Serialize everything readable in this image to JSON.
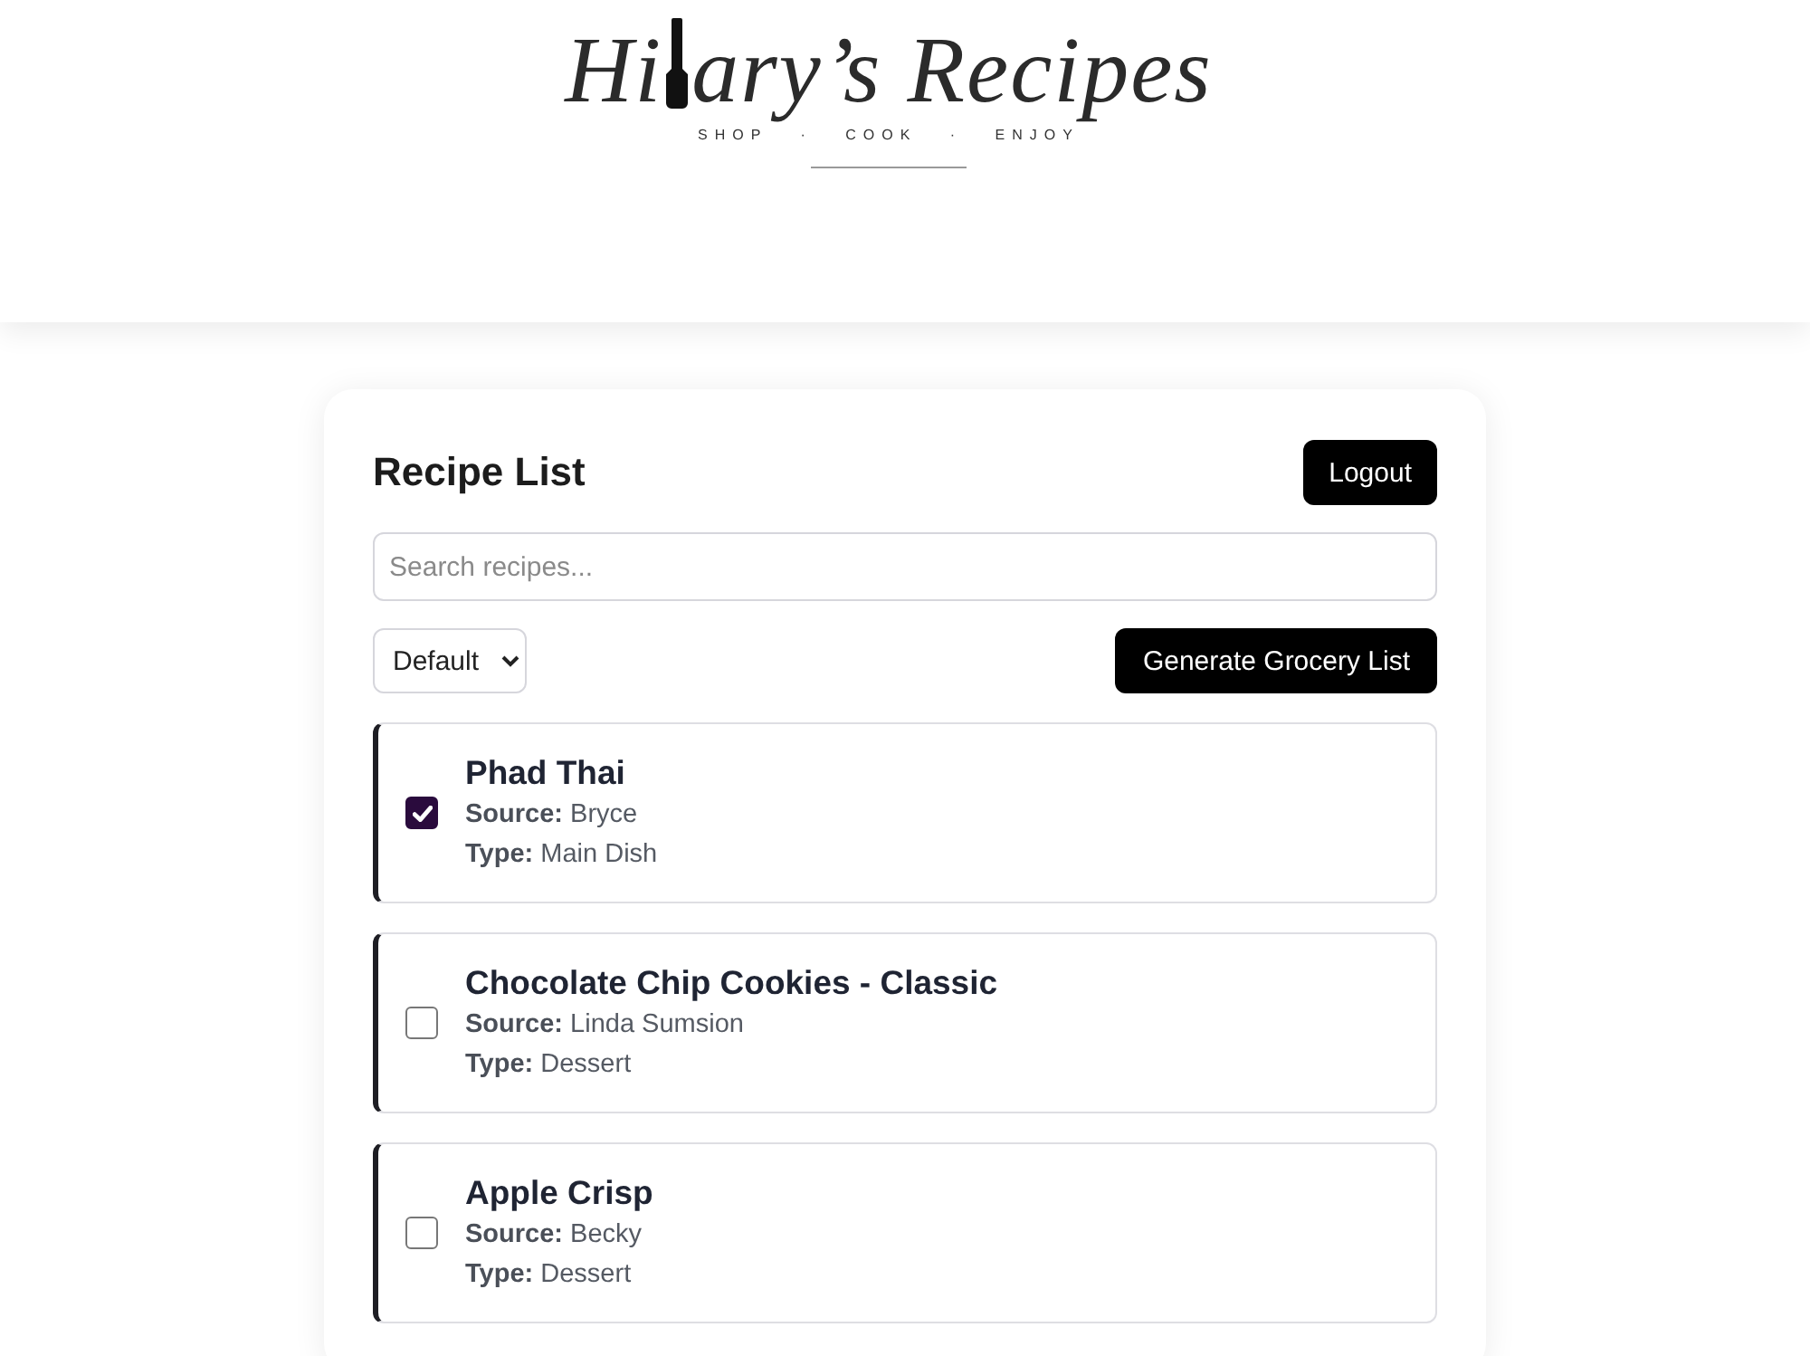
{
  "header": {
    "logo": {
      "title_start": "Hi",
      "title_end": "ary’s Recipes",
      "tagline": "SHOP · COOK · ENJOY"
    }
  },
  "card": {
    "title": "Recipe List",
    "logout_button": "Logout",
    "search": {
      "placeholder": "Search recipes..."
    },
    "sort_select": {
      "value": "Default"
    },
    "generate_button": "Generate Grocery List",
    "recipes": [
      {
        "name": "Phad Thai",
        "source": "**Source:** Bryce",
        "type": "**Type:** Main Dish",
        "checked": true
      },
      {
        "name": "Chocolate Chip Cookies - Classic",
        "source": "**Source:** Linda Sumsion",
        "type": "**Type:** Dessert",
        "checked": false
      },
      {
        "name": "Apple Crisp",
        "source": "**Source:** Becky",
        "type": "**Type:** Dessert",
        "checked": false
      }
    ]
  }
}
